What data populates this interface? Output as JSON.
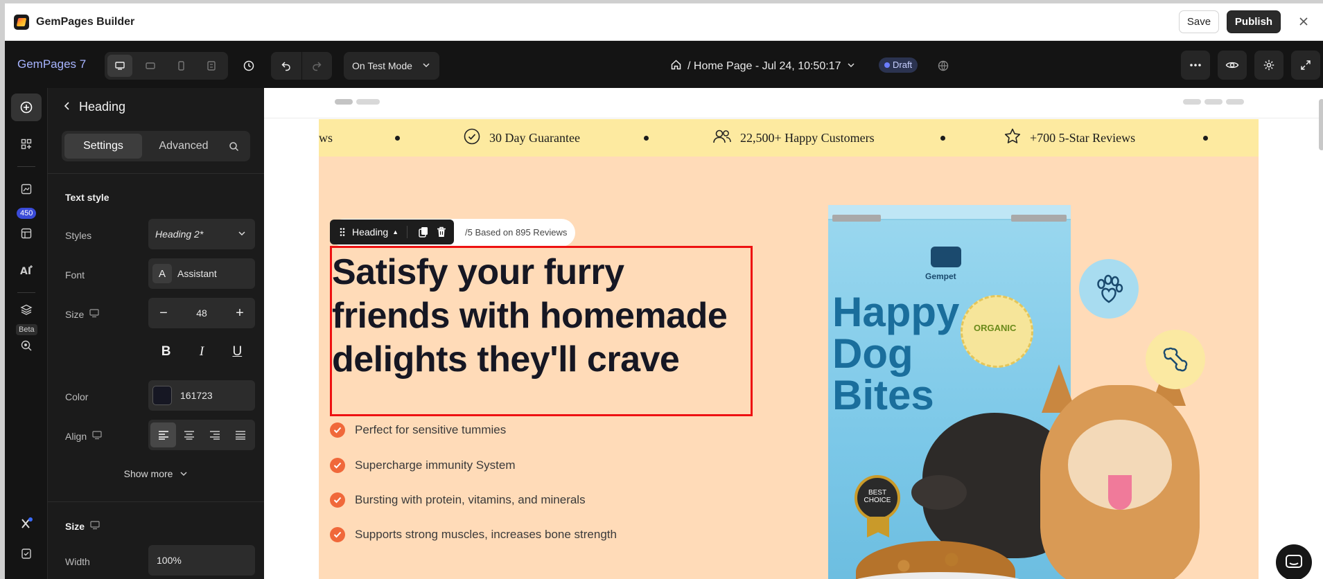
{
  "app": {
    "title": "GemPages Builder",
    "save_label": "Save",
    "publish_label": "Publish"
  },
  "toolbar": {
    "brand": "GemPages 7",
    "test_mode": "On Test Mode",
    "page_crumb": "/ Home Page - Jul 24, 10:50:17",
    "status": "Draft"
  },
  "rail": {
    "badge": "450",
    "beta": "Beta"
  },
  "panel": {
    "title": "Heading",
    "tabs": [
      "Settings",
      "Advanced"
    ],
    "text_style_title": "Text style",
    "styles_label": "Styles",
    "styles_value": "Heading 2*",
    "font_label": "Font",
    "font_value": "Assistant",
    "size_label": "Size",
    "size_value": "48",
    "color_label": "Color",
    "color_value": "161723",
    "align_label": "Align",
    "show_more": "Show more",
    "size_section_title": "Size",
    "width_label": "Width",
    "width_value": "100%"
  },
  "canvas": {
    "announcement": [
      {
        "text": "ews",
        "icon": "none"
      },
      {
        "text": "30 Day Guarantee",
        "icon": "check-badge-icon"
      },
      {
        "text": "22,500+ Happy Customers",
        "icon": "users-icon"
      },
      {
        "text": "+700 5-Star Reviews",
        "icon": "star-icon"
      }
    ],
    "rating_text": "/5 Based on 895 Reviews",
    "element_toolbar_label": "Heading",
    "heading": "Satisfy your furry friends with homemade delights they'll crave",
    "bullets": [
      "Perfect for sensitive tummies",
      "Supercharge immunity System",
      "Bursting with protein, vitamins, and minerals",
      "Supports strong muscles, increases bone strength"
    ],
    "product": {
      "brand": "Gempet",
      "bag_text": "Happy Dog Bites",
      "organic_badge": "ORGANIC",
      "best_badge": "BEST CHOICE"
    }
  },
  "colors": {
    "announcement_bg": "#fdeaa0",
    "hero_bg": "#ffdbb8",
    "heading_color": "#161723",
    "check_color": "#f0683a",
    "selection_outline": "#e11111"
  }
}
